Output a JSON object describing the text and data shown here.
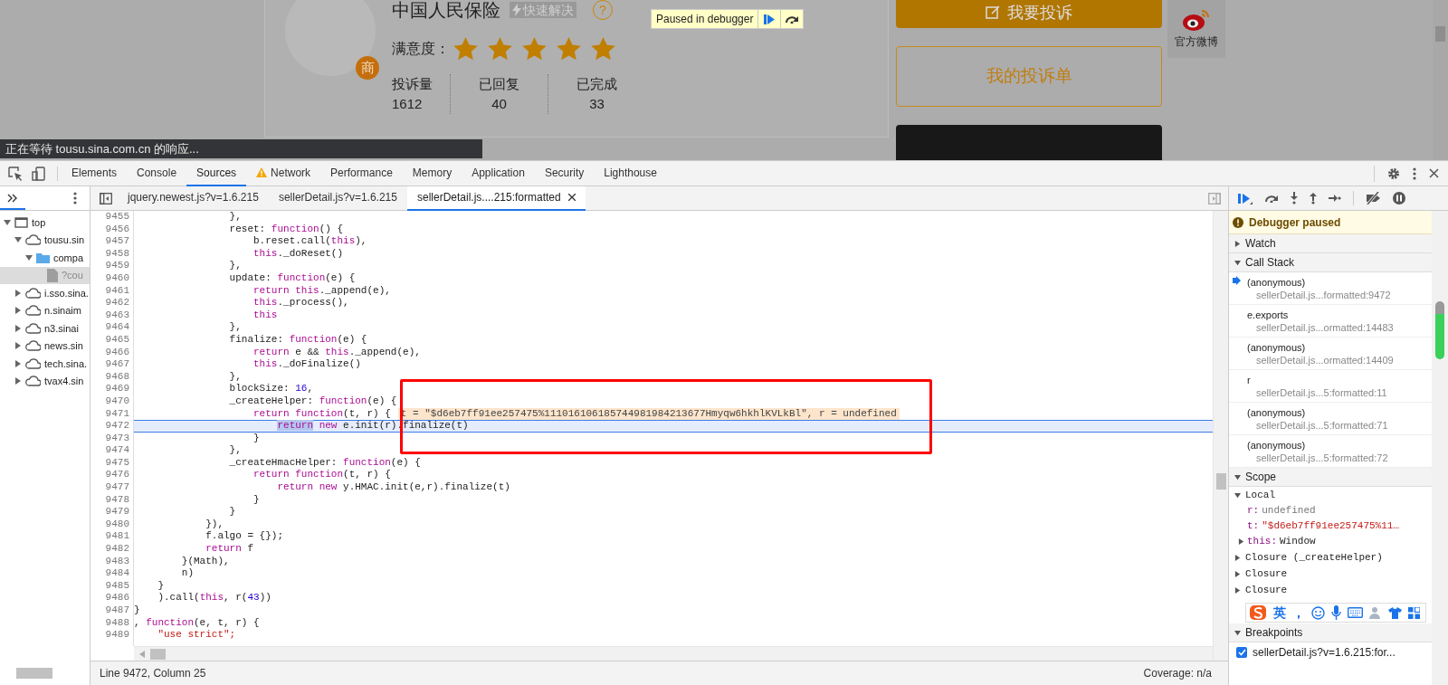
{
  "page": {
    "company": {
      "name": "中国人民保险",
      "badge": "快速解决",
      "help": "?",
      "merchant_tag": "商",
      "rating_label": "满意度：",
      "stars": 5,
      "stats": [
        {
          "label": "投诉量",
          "value": "1612"
        },
        {
          "label": "已回复",
          "value": "40"
        },
        {
          "label": "已完成",
          "value": "33"
        }
      ]
    },
    "paused_overlay": {
      "label": "Paused in debugger"
    },
    "actions": [
      {
        "label": "我要投诉",
        "kind": "filled"
      },
      {
        "label": "我的投诉单",
        "kind": "outline"
      },
      {
        "kind": "dark"
      }
    ],
    "weibo": {
      "label": "官方微博"
    },
    "status_bubble": "正在等待 tousu.sina.com.cn 的响应..."
  },
  "devtools": {
    "panel_tabs": [
      {
        "label": "Elements",
        "selected": false,
        "warning": false
      },
      {
        "label": "Console",
        "selected": false,
        "warning": false
      },
      {
        "label": "Sources",
        "selected": true,
        "warning": false
      },
      {
        "label": "Network",
        "selected": false,
        "warning": true
      },
      {
        "label": "Performance",
        "selected": false,
        "warning": false
      },
      {
        "label": "Memory",
        "selected": false,
        "warning": false
      },
      {
        "label": "Application",
        "selected": false,
        "warning": false
      },
      {
        "label": "Security",
        "selected": false,
        "warning": false
      },
      {
        "label": "Lighthouse",
        "selected": false,
        "warning": false
      }
    ],
    "navigator": {
      "tree": [
        {
          "label": "top",
          "kind": "frame",
          "expanded": true,
          "selected": false,
          "children": [
            {
              "label": "tousu.sin",
              "kind": "domain",
              "expanded": true,
              "selected": false,
              "children": [
                {
                  "label": "compa",
                  "kind": "folder",
                  "expanded": true,
                  "selected": false,
                  "children": [
                    {
                      "label": "?cou",
                      "kind": "file",
                      "expanded": false,
                      "selected": true
                    }
                  ]
                }
              ]
            },
            {
              "label": "i.sso.sina.",
              "kind": "domain",
              "expanded": false,
              "selected": false
            },
            {
              "label": "n.sinaim",
              "kind": "domain",
              "expanded": false,
              "selected": false
            },
            {
              "label": "n3.sinai",
              "kind": "domain",
              "expanded": false,
              "selected": false
            },
            {
              "label": "news.sin",
              "kind": "domain",
              "expanded": false,
              "selected": false
            },
            {
              "label": "tech.sina.",
              "kind": "domain",
              "expanded": false,
              "selected": false
            },
            {
              "label": "tvax4.sin",
              "kind": "domain",
              "expanded": false,
              "selected": false
            }
          ]
        }
      ]
    },
    "file_tabs": [
      {
        "label": "jquery.newest.js?v=1.6.215",
        "selected": false,
        "closable": false
      },
      {
        "label": "sellerDetail.js?v=1.6.215",
        "selected": false,
        "closable": false
      },
      {
        "label": "sellerDetail.js....215:formatted",
        "selected": true,
        "closable": true
      }
    ],
    "code": {
      "lines": [
        {
          "number": "9455",
          "current": false,
          "tokens": [
            {
              "kind": "plain",
              "text": "                },"
            }
          ]
        },
        {
          "number": "9456",
          "current": false,
          "tokens": [
            {
              "kind": "plain",
              "text": "                reset: "
            },
            {
              "kind": "keyword",
              "text": "function"
            },
            {
              "kind": "plain",
              "text": "() {"
            }
          ]
        },
        {
          "number": "9457",
          "current": false,
          "tokens": [
            {
              "kind": "plain",
              "text": "                    b.reset.call("
            },
            {
              "kind": "keyword",
              "text": "this"
            },
            {
              "kind": "plain",
              "text": "),"
            }
          ]
        },
        {
          "number": "9458",
          "current": false,
          "tokens": [
            {
              "kind": "keyword",
              "text": "                    this"
            },
            {
              "kind": "plain",
              "text": "._doReset()"
            }
          ]
        },
        {
          "number": "9459",
          "current": false,
          "tokens": [
            {
              "kind": "plain",
              "text": "                },"
            }
          ]
        },
        {
          "number": "9460",
          "current": false,
          "tokens": [
            {
              "kind": "plain",
              "text": "                update: "
            },
            {
              "kind": "keyword",
              "text": "function"
            },
            {
              "kind": "plain",
              "text": "(e) {"
            }
          ]
        },
        {
          "number": "9461",
          "current": false,
          "tokens": [
            {
              "kind": "keyword",
              "text": "                    return this"
            },
            {
              "kind": "plain",
              "text": "._append(e),"
            }
          ]
        },
        {
          "number": "9462",
          "current": false,
          "tokens": [
            {
              "kind": "keyword",
              "text": "                    this"
            },
            {
              "kind": "plain",
              "text": "._process(),"
            }
          ]
        },
        {
          "number": "9463",
          "current": false,
          "tokens": [
            {
              "kind": "keyword",
              "text": "                    this"
            }
          ]
        },
        {
          "number": "9464",
          "current": false,
          "tokens": [
            {
              "kind": "plain",
              "text": "                },"
            }
          ]
        },
        {
          "number": "9465",
          "current": false,
          "tokens": [
            {
              "kind": "plain",
              "text": "                finalize: "
            },
            {
              "kind": "keyword",
              "text": "function"
            },
            {
              "kind": "plain",
              "text": "(e) {"
            }
          ]
        },
        {
          "number": "9466",
          "current": false,
          "tokens": [
            {
              "kind": "keyword",
              "text": "                    return"
            },
            {
              "kind": "plain",
              "text": " e && "
            },
            {
              "kind": "keyword",
              "text": "this"
            },
            {
              "kind": "plain",
              "text": "._append(e),"
            }
          ]
        },
        {
          "number": "9467",
          "current": false,
          "tokens": [
            {
              "kind": "keyword",
              "text": "                    this"
            },
            {
              "kind": "plain",
              "text": "._doFinalize()"
            }
          ]
        },
        {
          "number": "9468",
          "current": false,
          "tokens": [
            {
              "kind": "plain",
              "text": "                },"
            }
          ]
        },
        {
          "number": "9469",
          "current": false,
          "tokens": [
            {
              "kind": "plain",
              "text": "                blockSize: "
            },
            {
              "kind": "number",
              "text": "16"
            },
            {
              "kind": "plain",
              "text": ","
            }
          ]
        },
        {
          "number": "9470",
          "current": false,
          "tokens": [
            {
              "kind": "plain",
              "text": "                _createHelper: "
            },
            {
              "kind": "keyword",
              "text": "function"
            },
            {
              "kind": "plain",
              "text": "(e) {"
            }
          ]
        },
        {
          "number": "9471",
          "current": false,
          "inline_value": "t = \"$d6eb7ff91ee257475%111016106185744981984213677Hmyqw6hkhlKVLkBl\", r = undefined",
          "tokens": [
            {
              "kind": "keyword",
              "text": "                    return function"
            },
            {
              "kind": "plain",
              "text": "(t, r) {"
            }
          ]
        },
        {
          "number": "9472",
          "current": true,
          "tokens": [
            {
              "kind": "selected",
              "text": "                        return"
            },
            {
              "kind": "keyword",
              "text": " new"
            },
            {
              "kind": "plain",
              "text": " e.init(r).finalize(t)"
            }
          ]
        },
        {
          "number": "9473",
          "current": false,
          "tokens": [
            {
              "kind": "plain",
              "text": "                    }"
            }
          ]
        },
        {
          "number": "9474",
          "current": false,
          "tokens": [
            {
              "kind": "plain",
              "text": "                },"
            }
          ]
        },
        {
          "number": "9475",
          "current": false,
          "tokens": [
            {
              "kind": "plain",
              "text": "                _createHmacHelper: "
            },
            {
              "kind": "keyword",
              "text": "function"
            },
            {
              "kind": "plain",
              "text": "(e) {"
            }
          ]
        },
        {
          "number": "9476",
          "current": false,
          "tokens": [
            {
              "kind": "keyword",
              "text": "                    return function"
            },
            {
              "kind": "plain",
              "text": "(t, r) {"
            }
          ]
        },
        {
          "number": "9477",
          "current": false,
          "tokens": [
            {
              "kind": "keyword",
              "text": "                        return new"
            },
            {
              "kind": "plain",
              "text": " y.HMAC.init(e,r).finalize(t)"
            }
          ]
        },
        {
          "number": "9478",
          "current": false,
          "tokens": [
            {
              "kind": "plain",
              "text": "                    }"
            }
          ]
        },
        {
          "number": "9479",
          "current": false,
          "tokens": [
            {
              "kind": "plain",
              "text": "                }"
            }
          ]
        },
        {
          "number": "9480",
          "current": false,
          "tokens": [
            {
              "kind": "plain",
              "text": "            }),"
            }
          ]
        },
        {
          "number": "9481",
          "current": false,
          "tokens": [
            {
              "kind": "plain",
              "text": "            f.algo = {});"
            }
          ]
        },
        {
          "number": "9482",
          "current": false,
          "tokens": [
            {
              "kind": "keyword",
              "text": "            return"
            },
            {
              "kind": "plain",
              "text": " f"
            }
          ]
        },
        {
          "number": "9483",
          "current": false,
          "tokens": [
            {
              "kind": "plain",
              "text": "        }(Math),"
            }
          ]
        },
        {
          "number": "9484",
          "current": false,
          "tokens": [
            {
              "kind": "plain",
              "text": "        n)"
            }
          ]
        },
        {
          "number": "9485",
          "current": false,
          "tokens": [
            {
              "kind": "plain",
              "text": "    }"
            }
          ]
        },
        {
          "number": "9486",
          "current": false,
          "tokens": [
            {
              "kind": "plain",
              "text": "    ).call("
            },
            {
              "kind": "keyword",
              "text": "this"
            },
            {
              "kind": "plain",
              "text": ", r("
            },
            {
              "kind": "number",
              "text": "43"
            },
            {
              "kind": "plain",
              "text": "))"
            }
          ]
        },
        {
          "number": "9487",
          "current": false,
          "tokens": [
            {
              "kind": "plain",
              "text": "}"
            }
          ]
        },
        {
          "number": "9488",
          "current": false,
          "tokens": [
            {
              "kind": "plain",
              "text": ", "
            },
            {
              "kind": "keyword",
              "text": "function"
            },
            {
              "kind": "plain",
              "text": "(e, t, r) {"
            }
          ]
        },
        {
          "number": "9489",
          "current": false,
          "tokens": [
            {
              "kind": "string",
              "text": "    \"use strict\";"
            }
          ]
        }
      ]
    },
    "status_bar": {
      "position": "Line 9472, Column 25",
      "coverage": "Coverage: n/a"
    },
    "sidebar": {
      "banner": "Debugger paused",
      "watch": {
        "title": "Watch",
        "expanded": false
      },
      "call_stack": {
        "title": "Call Stack",
        "expanded": true,
        "frames": [
          {
            "name": "(anonymous)",
            "location": "sellerDetail.js...formatted:9472",
            "selected": true
          },
          {
            "name": "e.exports",
            "location": "sellerDetail.js...ormatted:14483",
            "selected": false
          },
          {
            "name": "(anonymous)",
            "location": "sellerDetail.js...ormatted:14409",
            "selected": false
          },
          {
            "name": "r",
            "location": "sellerDetail.js...5:formatted:11",
            "selected": false
          },
          {
            "name": "(anonymous)",
            "location": "sellerDetail.js...5:formatted:71",
            "selected": false
          },
          {
            "name": "(anonymous)",
            "location": "sellerDetail.js...5:formatted:72",
            "selected": false
          }
        ]
      },
      "scope": {
        "title": "Scope",
        "expanded": true,
        "scopes": [
          {
            "label": "Local",
            "expanded": true,
            "vars": [
              {
                "name": "r:",
                "value": "undefined",
                "kind": "undefined"
              },
              {
                "name": "t:",
                "value": "\"$d6eb7ff91ee257475%11…",
                "kind": "string"
              },
              {
                "name": "this:",
                "value": "Window",
                "kind": "object"
              }
            ]
          },
          {
            "label": "Closure (_createHelper)",
            "expanded": false
          },
          {
            "label": "Closure",
            "expanded": false
          },
          {
            "label": "Closure",
            "expanded": false
          }
        ]
      },
      "breakpoints": {
        "title": "Breakpoints",
        "expanded": true,
        "items": [
          {
            "label": "sellerDetail.js?v=1.6.215:for...",
            "checked": true
          }
        ]
      }
    },
    "ime_toolbar": {
      "mode": "英",
      "punctuation": "，"
    }
  }
}
